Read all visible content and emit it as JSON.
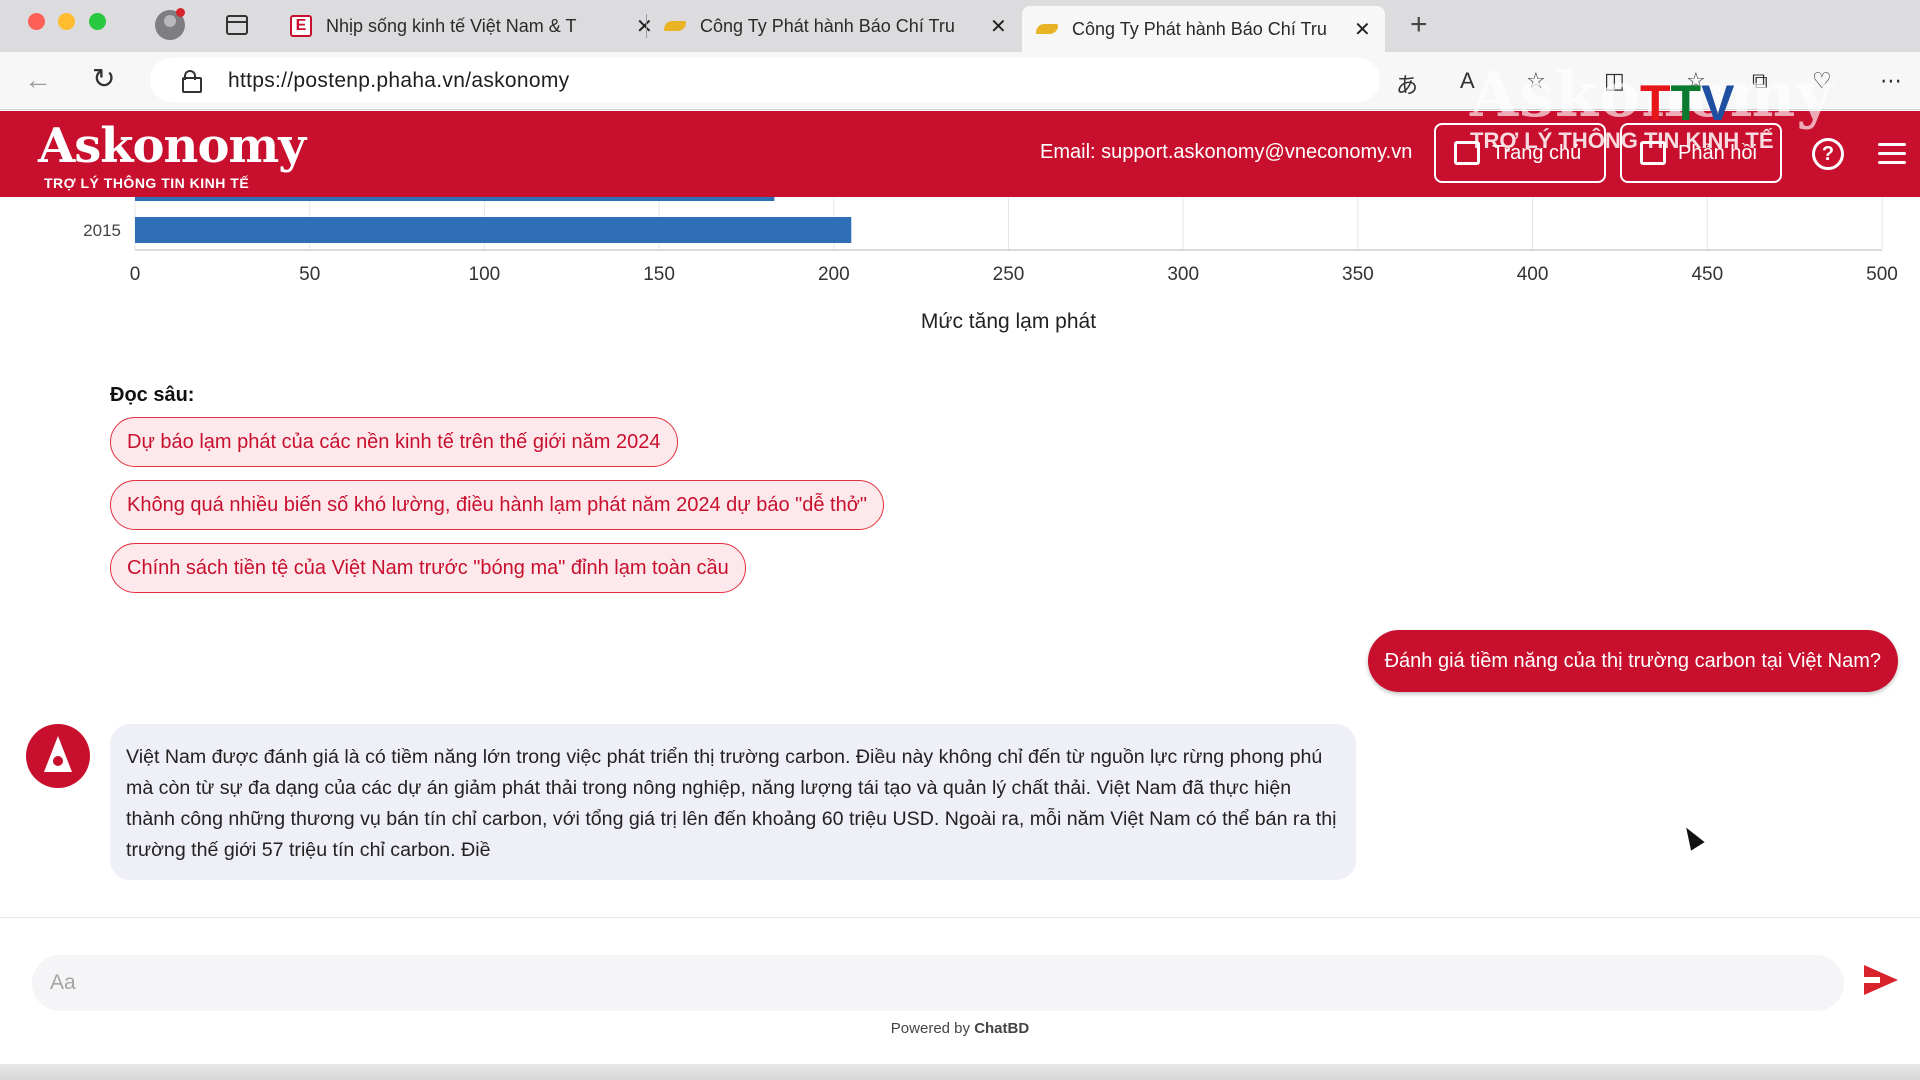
{
  "browser": {
    "tabs": [
      {
        "title": "Nhịp sống kinh tế Việt Nam & T",
        "favicon": "e-magazine-icon",
        "active": false
      },
      {
        "title": "Công Ty Phát hành Báo Chí Tru",
        "favicon": "bird-icon",
        "active": false
      },
      {
        "title": "Công Ty Phát hành Báo Chí Tru",
        "favicon": "bird-icon",
        "active": true
      }
    ],
    "url": "https://postenp.phaha.vn/askonomy"
  },
  "watermark": {
    "brand": "Askonomy",
    "channel": "TTV",
    "sub": "TRỢ LÝ THÔNG TIN KINH TẾ"
  },
  "header": {
    "logo_name": "Askonomy",
    "logo_tagline": "TRỢ LÝ THÔNG TIN KINH TẾ",
    "email": "Email: support.askonomy@vneconomy.vn",
    "home_label": "Trang chủ",
    "feedback_label": "Phản hồi",
    "help_symbol": "?"
  },
  "chart_data": {
    "type": "bar",
    "orientation": "horizontal",
    "categories": [
      "",
      "2015"
    ],
    "values": [
      183,
      205
    ],
    "xlabel": "Mức tăng lạm phát",
    "xlim": [
      0,
      500
    ],
    "xticks": [
      0,
      50,
      100,
      150,
      200,
      250,
      300,
      350,
      400,
      450,
      500
    ],
    "bar_color": "#2e6fb7",
    "grid": true
  },
  "reading": {
    "title": "Đọc sâu:",
    "items": [
      "Dự báo lạm phát của các nền kinh tế trên thế giới năm 2024",
      "Không quá nhiều biến số khó lường, điều hành lạm phát năm 2024 dự báo \"dễ thở\"",
      "Chính sách tiền tệ của Việt Nam trước \"bóng ma\" đỉnh lạm toàn cầu"
    ]
  },
  "messages": {
    "user": "Đánh giá tiềm năng của thị trường carbon tại Việt Nam?",
    "bot": "Việt Nam được đánh giá là có tiềm năng lớn trong việc phát triển thị trường carbon. Điều này không chỉ đến từ nguồn lực rừng phong phú mà còn từ sự đa dạng của các dự án giảm phát thải trong nông nghiệp, năng lượng tái tạo và quản lý chất thải. Việt Nam đã thực hiện thành công những thương vụ bán tín chỉ carbon, với tổng giá trị lên đến khoảng 60 triệu USD. Ngoài ra, mỗi năm Việt Nam có thể bán ra thị trường thế giới 57 triệu tín chỉ carbon. Điề"
  },
  "composer": {
    "placeholder": "Aa",
    "powered_prefix": "Powered by ",
    "powered_brand": "ChatBD"
  },
  "colors": {
    "brand": "#c8102e",
    "chip_bg": "#fde9ec"
  }
}
